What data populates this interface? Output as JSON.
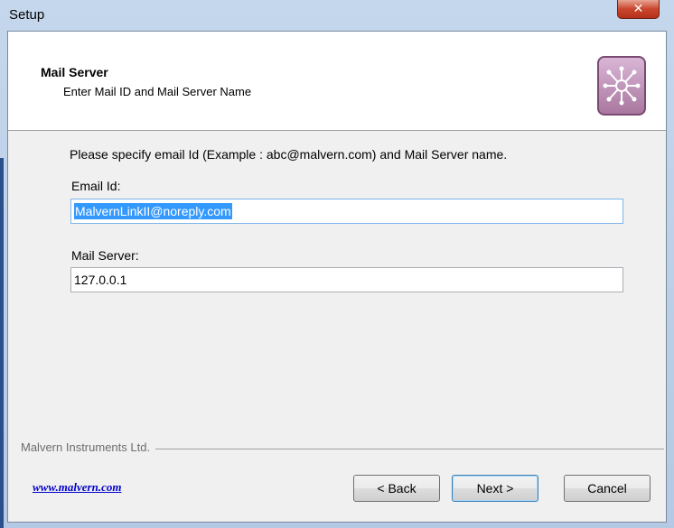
{
  "window": {
    "title": "Setup",
    "close_glyph": "✕"
  },
  "header": {
    "title": "Mail Server",
    "subtitle": "Enter Mail ID and Mail Server Name",
    "logo_icon": "network-hub-icon"
  },
  "body": {
    "instruction": "Please specify email Id (Example : abc@malvern.com) and Mail Server name.",
    "email_label": "Email Id:",
    "email_value": "MalvernLinkII@noreply.com",
    "server_label": "Mail Server:",
    "server_value": "127.0.0.1"
  },
  "footer": {
    "company": "Malvern Instruments Ltd.",
    "link": "www.malvern.com",
    "back_label": "< Back",
    "next_label": "Next >",
    "cancel_label": "Cancel"
  },
  "colors": {
    "selection": "#3399ff",
    "link": "#0000cc",
    "close_button": "#c9462c",
    "logo": "#a9779f"
  }
}
